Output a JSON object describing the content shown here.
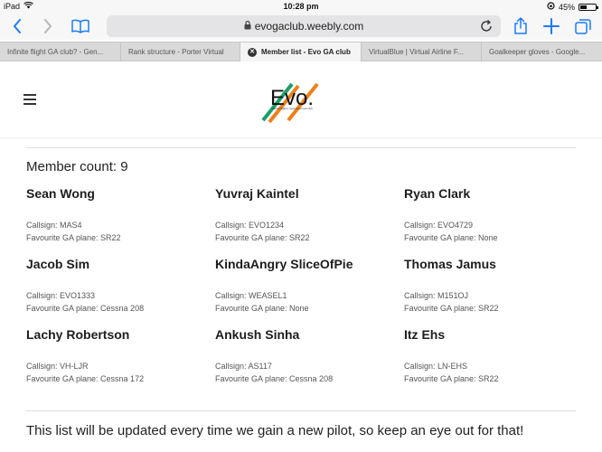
{
  "status": {
    "device": "iPad",
    "time": "10:28 pm",
    "battery": "45%",
    "battery_level": 0.45
  },
  "toolbar": {
    "url": "evogaclub.weebly.com"
  },
  "tabs": [
    {
      "label": "Infinite flight GA club? - Gen...",
      "active": false
    },
    {
      "label": "Rank structure - Porter Virtual",
      "active": false
    },
    {
      "label": "Member list - Evo GA club",
      "active": true
    },
    {
      "label": "VirtualBlue | Virtual Airline F...",
      "active": false
    },
    {
      "label": "Goalkeeper gloves - Google...",
      "active": false
    }
  ],
  "header": {
    "logo_text": "Evo.",
    "logo_tagline": "Infinite flight's most loved GA club",
    "colors": {
      "green": "#1a9e6a",
      "orange": "#ef7f1a"
    }
  },
  "content": {
    "member_count": "Member count: 9",
    "callsign_label": "Callsign: ",
    "plane_label": "Favourite GA plane: ",
    "members": [
      {
        "name": "Sean Wong",
        "callsign": "Callsign: MAS4",
        "plane": "Favourite GA plane: SR22"
      },
      {
        "name": "Yuvraj Kaintel",
        "callsign": "Callsign: EVO1234",
        "plane": "Favourite GA plane: SR22"
      },
      {
        "name": "Ryan Clark",
        "callsign": "Callsign: EVO4729",
        "plane": "Favourite GA plane: None"
      },
      {
        "name": "Jacob Sim",
        "callsign": "Callsign: EVO1333",
        "plane": "Favourite GA plane: Cessna 208"
      },
      {
        "name": "KindaAngry SliceOfPie",
        "callsign": "Callsign: WEASEL1",
        "plane": "Favourite GA plane: None"
      },
      {
        "name": "Thomas Jamus",
        "callsign": "Callsign: M151OJ",
        "plane": "Favourite GA plane: SR22"
      },
      {
        "name": "Lachy Robertson",
        "callsign": "Callsign: VH-LJR",
        "plane": "Favourite GA plane: Cessna 172"
      },
      {
        "name": "Ankush Sinha",
        "callsign": "Callsign: AS117",
        "plane": "Favourite GA plane: Cessna 208"
      },
      {
        "name": "Itz Ehs",
        "callsign": "Callsign: LN-EHS",
        "plane": "Favourite GA plane: SR22"
      }
    ],
    "footer": "This list will be updated every time we gain a new pilot, so keep an eye out for that!"
  }
}
